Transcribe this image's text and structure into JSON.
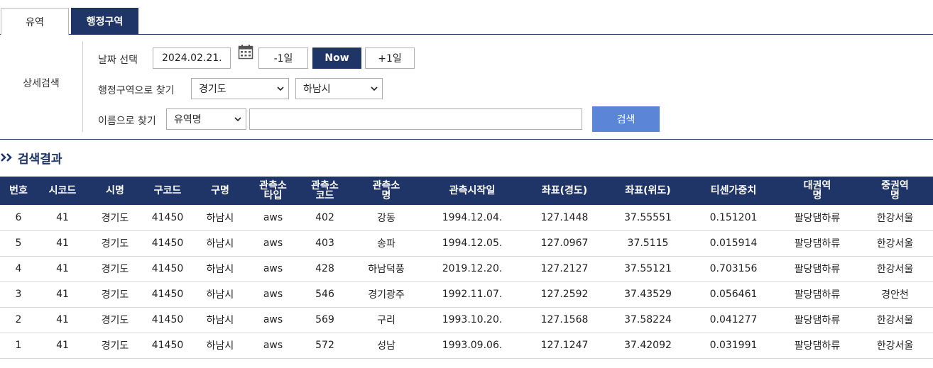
{
  "tabs": [
    {
      "label": "유역",
      "active": false
    },
    {
      "label": "행정구역",
      "active": true
    }
  ],
  "search": {
    "section_label": "상세검색",
    "date": {
      "label": "날짜 선택",
      "value": "2024.02.21.",
      "prev_label": "-1일",
      "now_label": "Now",
      "next_label": "+1일"
    },
    "region": {
      "label": "행정구역으로 찾기",
      "province_selected": "경기도",
      "city_selected": "하남시"
    },
    "name": {
      "label": "이름으로 찾기",
      "type_selected": "유역명",
      "query_value": "",
      "search_label": "검색"
    }
  },
  "results": {
    "title": "검색결과",
    "columns": [
      "번호",
      "시코드",
      "시명",
      "구코드",
      "구명",
      "관측소\n타입",
      "관측소\n코드",
      "관측소\n명",
      "관측시작일",
      "좌표(경도)",
      "좌표(위도)",
      "티센가중치",
      "대권역\n명",
      "중권역\n명"
    ],
    "rows": [
      [
        "6",
        "41",
        "경기도",
        "41450",
        "하남시",
        "aws",
        "402",
        "강동",
        "1994.12.04.",
        "127.1448",
        "37.55551",
        "0.151201",
        "팔당댐하류",
        "한강서울"
      ],
      [
        "5",
        "41",
        "경기도",
        "41450",
        "하남시",
        "aws",
        "403",
        "송파",
        "1994.12.05.",
        "127.0967",
        "37.5115",
        "0.015914",
        "팔당댐하류",
        "한강서울"
      ],
      [
        "4",
        "41",
        "경기도",
        "41450",
        "하남시",
        "aws",
        "428",
        "하남덕풍",
        "2019.12.20.",
        "127.2127",
        "37.55121",
        "0.703156",
        "팔당댐하류",
        "한강서울"
      ],
      [
        "3",
        "41",
        "경기도",
        "41450",
        "하남시",
        "aws",
        "546",
        "경기광주",
        "1992.11.07.",
        "127.2592",
        "37.43529",
        "0.056461",
        "팔당댐하류",
        "경안천"
      ],
      [
        "2",
        "41",
        "경기도",
        "41450",
        "하남시",
        "aws",
        "569",
        "구리",
        "1993.10.20.",
        "127.1568",
        "37.58224",
        "0.041277",
        "팔당댐하류",
        "한강서울"
      ],
      [
        "1",
        "41",
        "경기도",
        "41450",
        "하남시",
        "aws",
        "572",
        "성남",
        "1993.09.06.",
        "127.1247",
        "37.42092",
        "0.031991",
        "팔당댐하류",
        "한강서울"
      ]
    ]
  },
  "colors": {
    "navy": "#1f3467",
    "search_button": "#5b85d6"
  }
}
